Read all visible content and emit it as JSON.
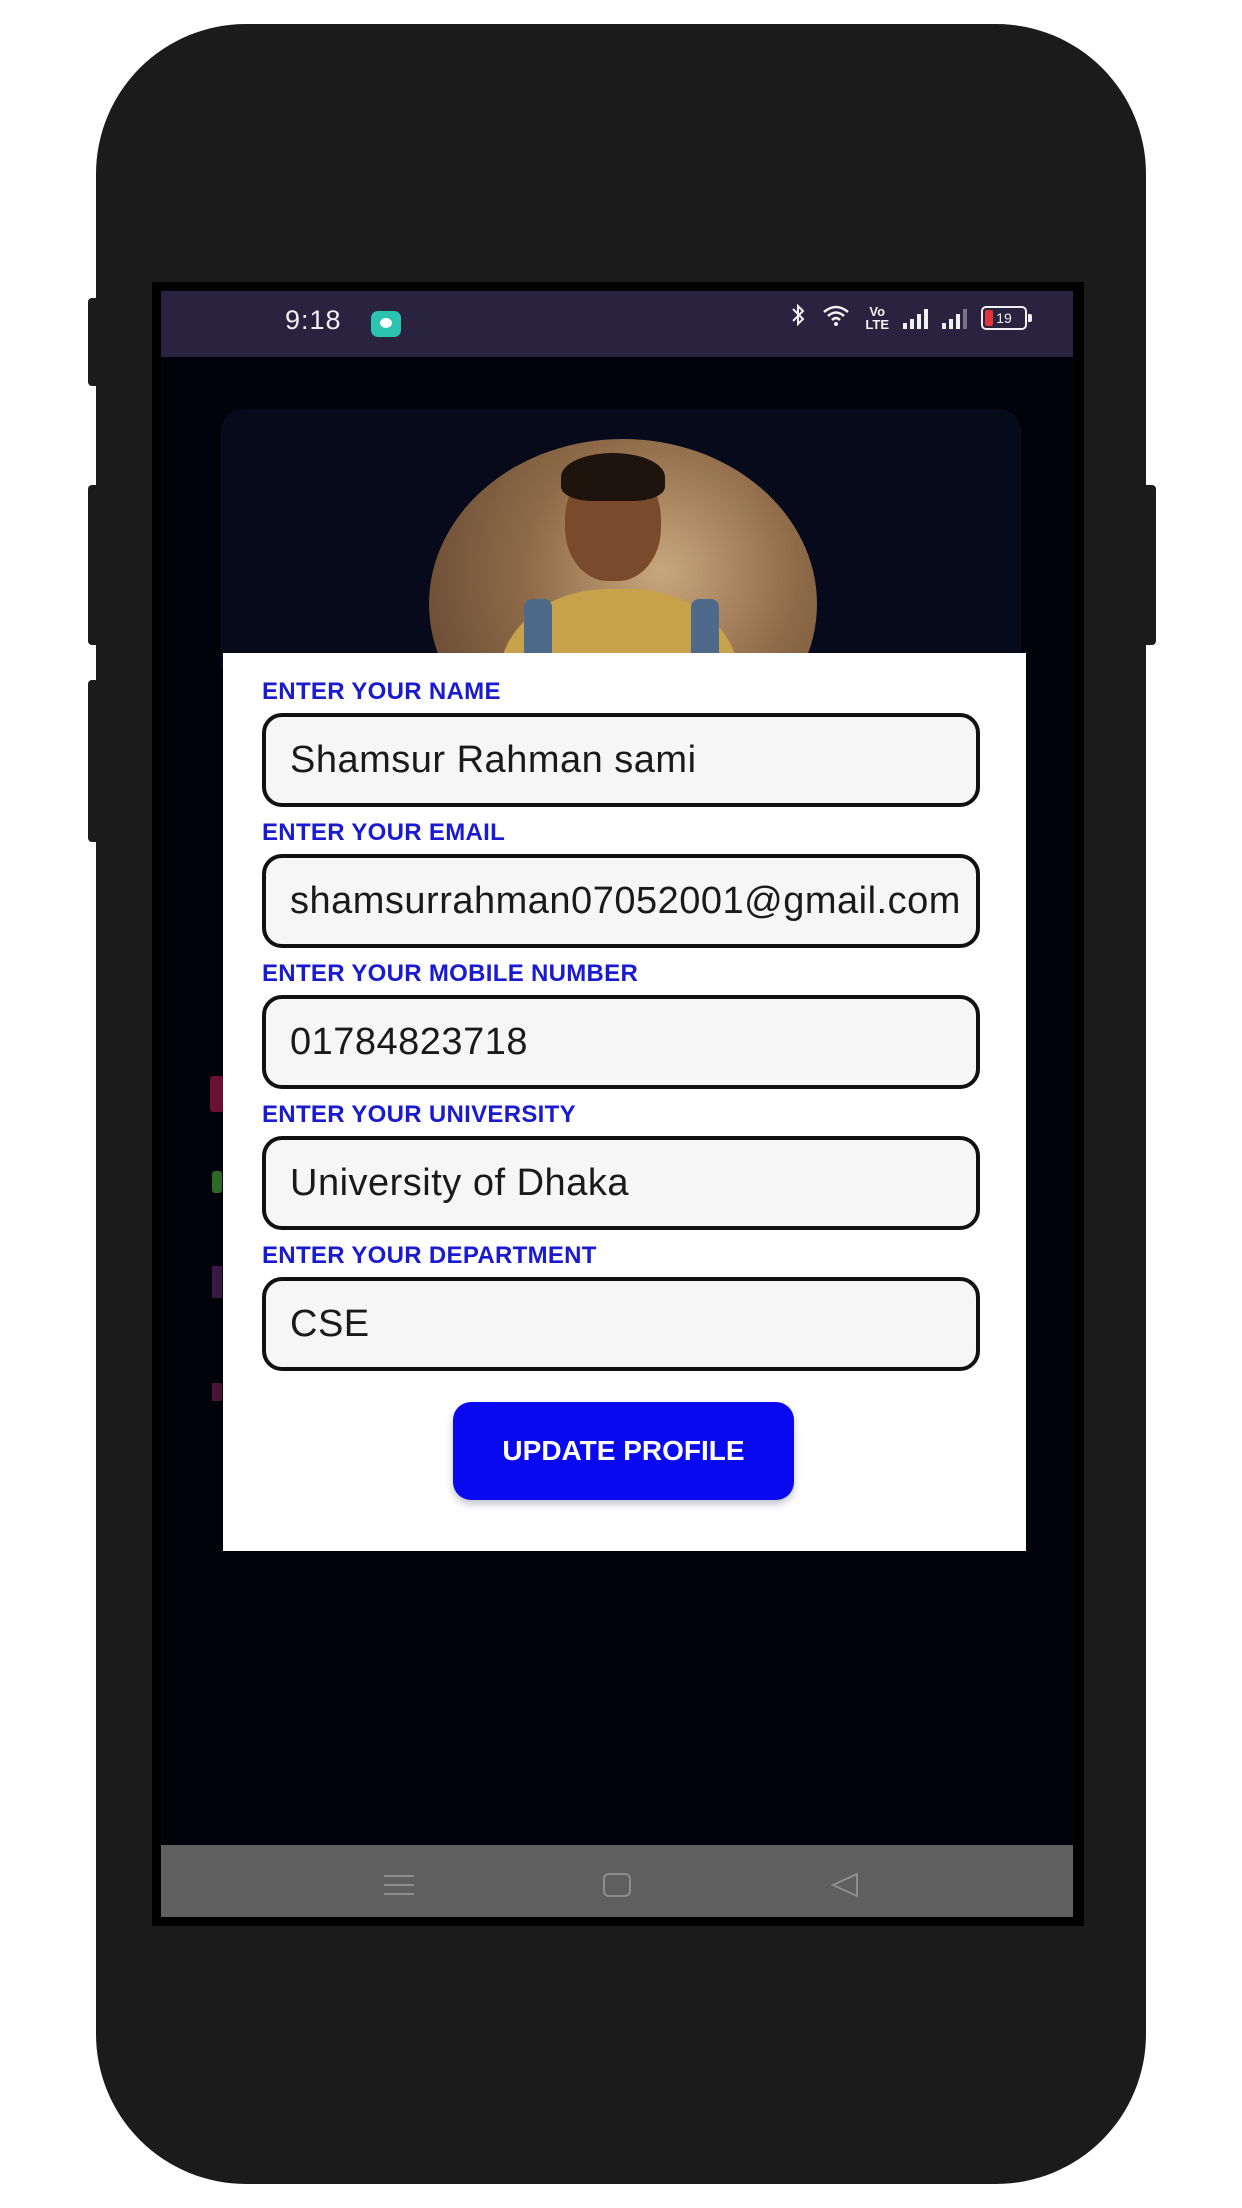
{
  "status_bar": {
    "time": "9:18",
    "battery": "19",
    "volte": "Vo\nLTE",
    "icons": [
      "message-icon",
      "bluetooth-icon",
      "wifi-icon",
      "volte-icon",
      "signal-icon",
      "signal-icon",
      "battery-icon"
    ]
  },
  "profile": {
    "avatar_icon": "profile-photo"
  },
  "form": {
    "name_label": "ENTER YOUR NAME",
    "name_value": "Shamsur Rahman sami",
    "email_label": "ENTER YOUR EMAIL",
    "email_value": "shamsurrahman07052001@gmail.com",
    "mobile_label": "ENTER YOUR MOBILE NUMBER",
    "mobile_value": "01784823718",
    "university_label": "ENTER YOUR UNIVERSITY",
    "university_value": "University of Dhaka",
    "department_label": "ENTER YOUR DEPARTMENT",
    "department_value": "CSE",
    "submit_label": "UPDATE PROFILE"
  },
  "nav_bar": {
    "icons": [
      "menu-icon",
      "home-icon",
      "back-icon"
    ]
  },
  "colors": {
    "label": "#1a1ad0",
    "button": "#0a0af0",
    "status_bar": "#2a2340"
  }
}
